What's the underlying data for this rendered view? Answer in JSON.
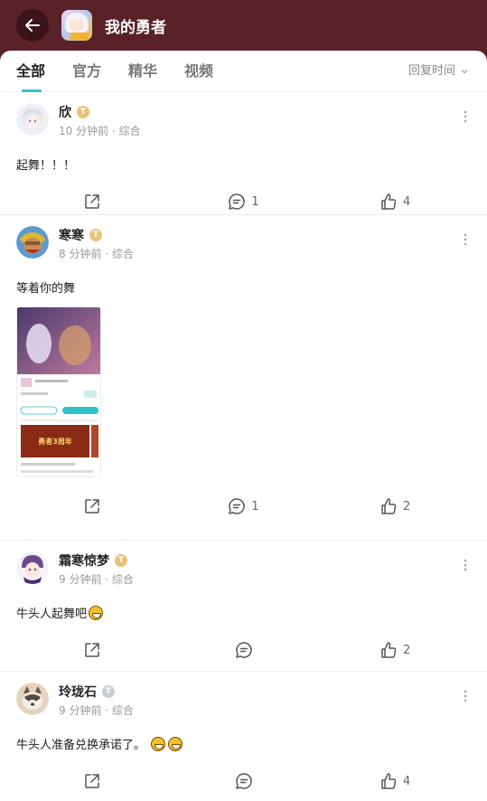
{
  "header": {
    "title": "我的勇者"
  },
  "tabs": [
    "全部",
    "官方",
    "精华",
    "视频"
  ],
  "sort_label": "回复时间",
  "posts": [
    {
      "user": "欣",
      "time": "10 分钟前 · 综合",
      "content": "起舞！！！",
      "comments": "1",
      "likes": "4",
      "level": "gold"
    },
    {
      "user": "寒寒",
      "time": "8 分钟前 · 综合",
      "content": "等着你的舞",
      "comments": "1",
      "likes": "2",
      "level": "gold"
    },
    {
      "user": "霜寒惊梦",
      "time": "9 分钟前 · 综合",
      "content": "牛头人起舞吧",
      "comments": "",
      "likes": "2",
      "level": "gold"
    },
    {
      "user": "玲珑石",
      "time": "9 分钟前 · 综合",
      "content": "牛头人准备兑换承诺了。",
      "comments": "",
      "likes": "4",
      "level": "silver"
    }
  ],
  "thumbnail": {
    "banner_text": "勇者3周年"
  },
  "colors": {
    "header_bg": "#5a2128",
    "accent": "#2bc4c8",
    "level_gold": "#e9c27a"
  }
}
